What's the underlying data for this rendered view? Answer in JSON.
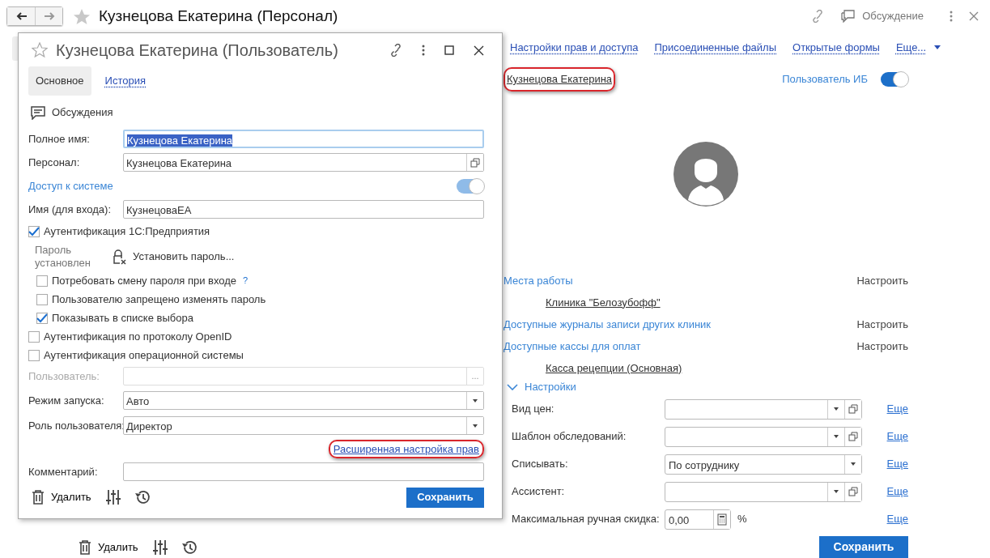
{
  "page": {
    "title": "Кузнецова Екатерина (Персонал)",
    "discussion": "Обсуждение",
    "links": [
      "Настройки прав и доступа",
      "Присоединенные файлы",
      "Открытые формы",
      "Еще..."
    ],
    "user_link": {
      "text": "Кузнецова Екатерина",
      "highlighted": true
    },
    "ib_user": {
      "label": "Пользователь ИБ",
      "on": true
    },
    "sections": [
      {
        "kind": "header",
        "title": "Места работы",
        "action": "Настроить"
      },
      {
        "kind": "item",
        "text": "Клиника \"Белозубофф\""
      },
      {
        "kind": "header",
        "title": "Доступные журналы записи других клиник",
        "action": "Настроить"
      },
      {
        "kind": "header",
        "title": "Доступные кассы для оплат",
        "action": "Настроить"
      },
      {
        "kind": "item",
        "text": "Касса рецепции (Основная)"
      }
    ],
    "settings": {
      "title": "Настройки",
      "expanded": true,
      "fields": [
        {
          "kind": "select_open",
          "label": "Вид цен:",
          "more": "Еще"
        },
        {
          "kind": "select_open",
          "label": "Шаблон обследований:",
          "more": "Еще"
        },
        {
          "kind": "select",
          "label": "Списывать:",
          "value": "По сотруднику",
          "more": "Еще"
        },
        {
          "kind": "select_open",
          "label": "Ассистент:",
          "more": "Еще"
        },
        {
          "kind": "number",
          "label": "Максимальная ручная скидка:",
          "value": "0,00",
          "unit": "%",
          "more": "Еще"
        }
      ]
    },
    "delete": "Удалить",
    "save": "Сохранить"
  },
  "dialog": {
    "title": "Кузнецова Екатерина (Пользователь)",
    "tabs": [
      {
        "label": "Основное",
        "selected": true
      },
      {
        "label": "История",
        "selected": false
      }
    ],
    "discussions": "Обсуждения",
    "rows": [
      {
        "kind": "text",
        "label": "Полное имя:",
        "value": "Кузнецова Екатерина",
        "focused": true
      },
      {
        "kind": "open",
        "label": "Персонал:",
        "value": "Кузнецова Екатерина"
      },
      {
        "kind": "toggle",
        "label": "Доступ к системе",
        "on": true
      },
      {
        "kind": "text",
        "label": "Имя (для входа):",
        "value": "КузнецоваЕА"
      },
      {
        "kind": "checkbox",
        "label": "Аутентификация 1С:Предприятия",
        "checked": true,
        "password_status": "Пароль установлен",
        "password_button": "Установить пароль...",
        "children": [
          {
            "label": "Потребовать смену пароля при входе",
            "checked": false,
            "help": "?"
          },
          {
            "label": "Пользователю запрещено изменять пароль",
            "checked": false
          },
          {
            "label": "Показывать в списке выбора",
            "checked": true
          }
        ]
      },
      {
        "kind": "checkbox",
        "label": "Аутентификация по протоколу OpenID",
        "checked": false
      },
      {
        "kind": "checkbox",
        "label": "Аутентификация операционной системы",
        "checked": false
      },
      {
        "kind": "choice",
        "label": "Пользователь:",
        "disabled": true,
        "button": "..."
      },
      {
        "kind": "select",
        "label": "Режим запуска:",
        "value": "Авто"
      },
      {
        "kind": "select",
        "label": "Роль пользователя:",
        "value": "Директор"
      },
      {
        "kind": "link",
        "text": "Расширенная настройка прав",
        "highlighted": true
      },
      {
        "kind": "text",
        "label": "Комментарий:"
      }
    ],
    "delete": "Удалить",
    "save": "Сохранить"
  }
}
